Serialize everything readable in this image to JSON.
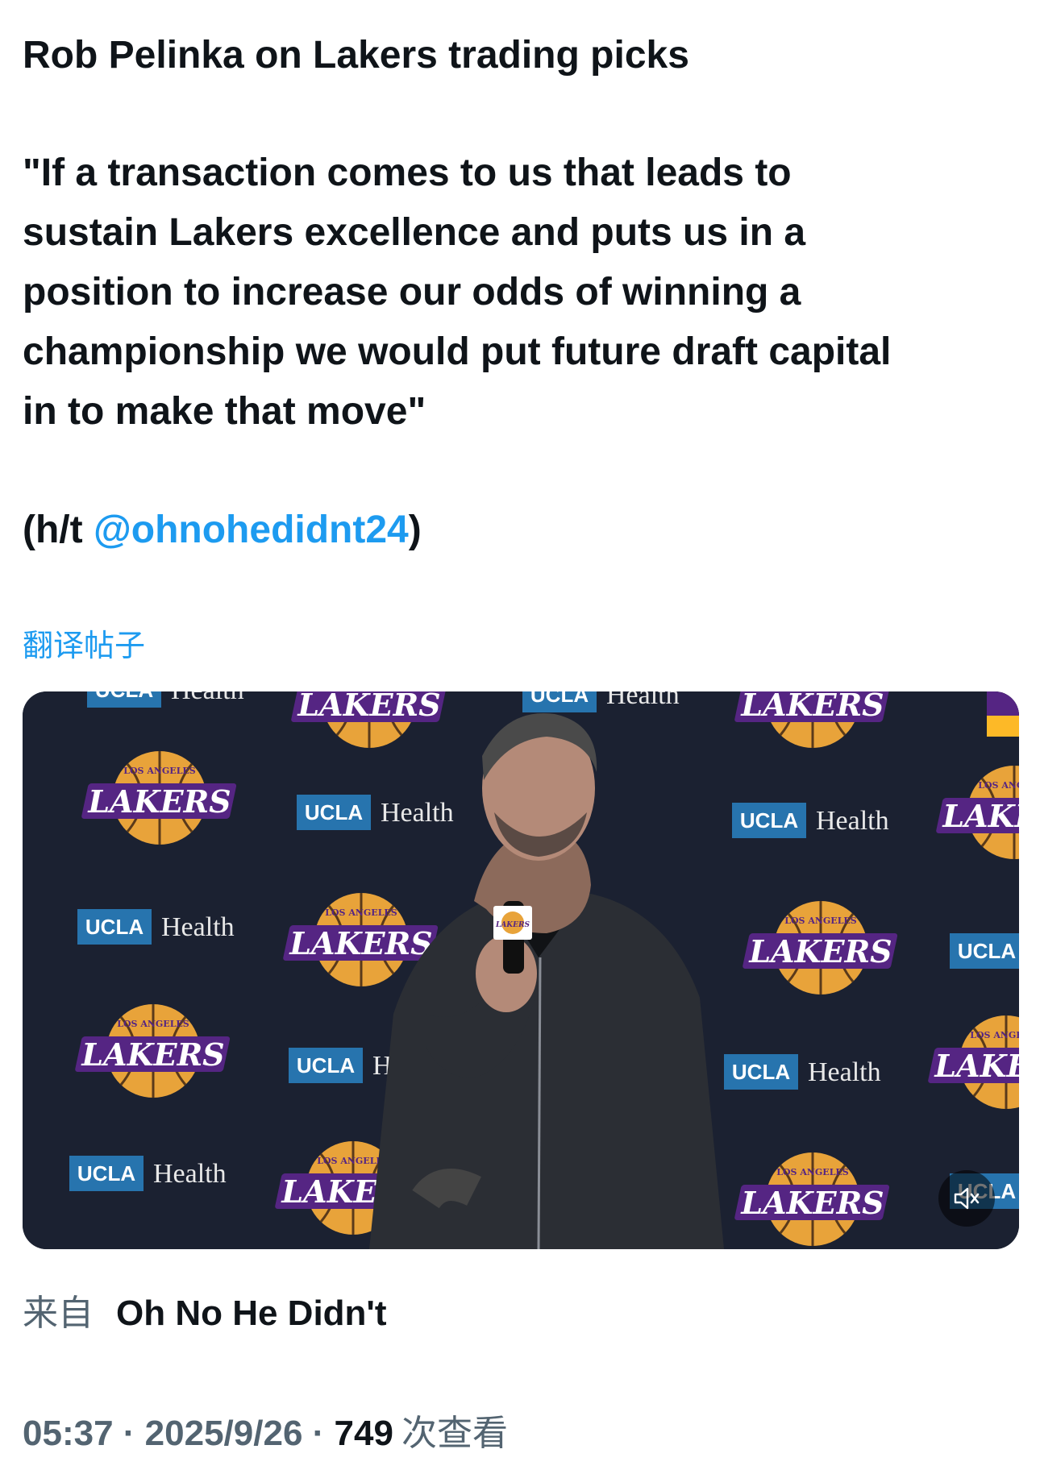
{
  "tweet": {
    "title": "Rob Pelinka on Lakers trading picks",
    "quote_lines": [
      "\"If a transaction comes to us that leads to",
      "sustain Lakers excellence and puts us in a",
      "position to increase our odds of winning a",
      "championship we would put future draft capital",
      "in to make that move\""
    ],
    "hat_tip_prefix": "(h/t ",
    "hat_tip_handle": "@ohnohedidnt24",
    "hat_tip_suffix": ")",
    "translate_label": "翻译帖子"
  },
  "video": {
    "backdrop_brand_1": "UCLA",
    "backdrop_brand_2": "Health",
    "backdrop_logo": "LAKERS",
    "backdrop_logo_top": "LOS ANGELES",
    "mute_icon": "volume-muted-icon"
  },
  "source": {
    "prefix": "来自",
    "name": "Oh No He Didn't"
  },
  "meta": {
    "time": "05:37",
    "date": "2025/9/26",
    "views": "749",
    "views_label": "次查看",
    "separator": "·"
  },
  "colors": {
    "link": "#1d9bf0",
    "text": "#0f1419",
    "muted": "#536471",
    "lakers_purple": "#552583",
    "lakers_gold": "#fdb927"
  }
}
